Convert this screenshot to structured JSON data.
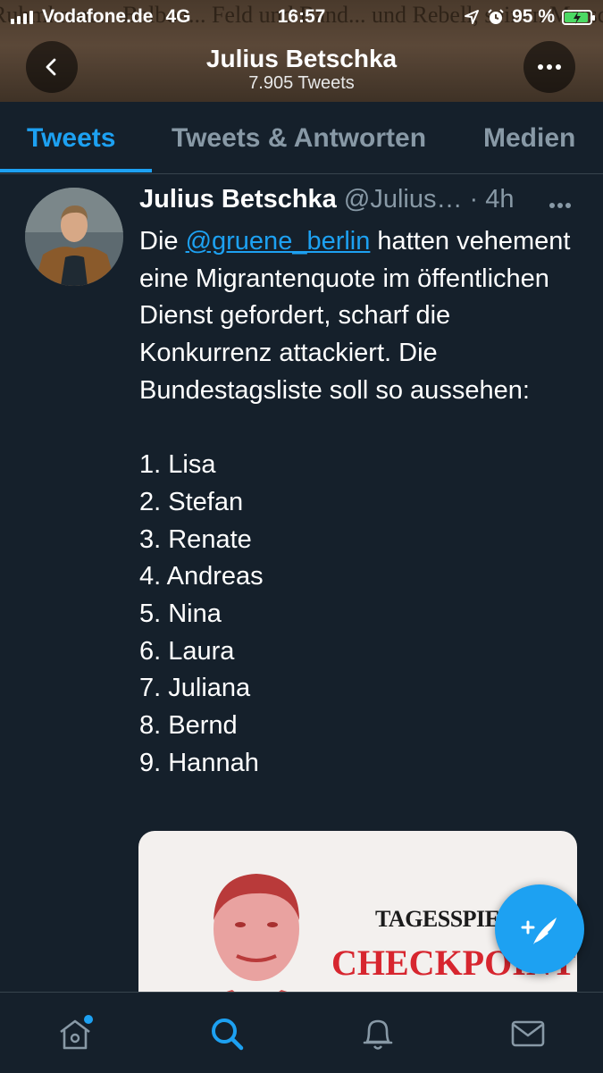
{
  "status_bar": {
    "carrier": "Vodafone.de",
    "network": "4G",
    "time": "16:57",
    "battery_percent": "95 %",
    "battery_level": 0.95
  },
  "profile_header": {
    "name": "Julius Betschka",
    "tweet_count": "7.905 Tweets",
    "background_text": "Ruhmkranz... Balboa... Feld und Band... und Rebell, seinen Marsch in die Unsterblichkeit."
  },
  "tabs": [
    {
      "label": "Tweets",
      "active": true
    },
    {
      "label": "Tweets & Antworten",
      "active": false
    },
    {
      "label": "Medien",
      "active": false
    }
  ],
  "tweet": {
    "author_name": "Julius Betschka",
    "author_handle": "@Julius…",
    "time": "· 4h",
    "text_before_mention": "Die ",
    "mention": "@gruene_berlin",
    "text_after_mention": " hatten vehement eine Migrantenquote im öffentlichen Dienst gefordert, scharf die Konkurrenz attackiert. Die Bundestagsliste soll so aussehen:",
    "list": [
      "1. Lisa",
      "2. Stefan",
      "3. Renate",
      "4. Andreas",
      "5. Nina",
      "6. Laura",
      "7. Juliana",
      "8. Bernd",
      "9. Hannah"
    ],
    "media": {
      "logo_text": "TAGESSPIEGEL",
      "title_text": "CHECKPOINT"
    }
  },
  "colors": {
    "background": "#15202b",
    "accent": "#1da1f2",
    "secondary_text": "#8899a6",
    "divider": "#38444d",
    "checkpoint_red": "#d7262f"
  },
  "icons": {
    "back": "chevron-left-icon",
    "more": "more-horizontal-icon",
    "compose": "compose-feather-icon",
    "home": "home-icon",
    "search": "search-icon",
    "notifications": "bell-icon",
    "messages": "mail-icon"
  }
}
